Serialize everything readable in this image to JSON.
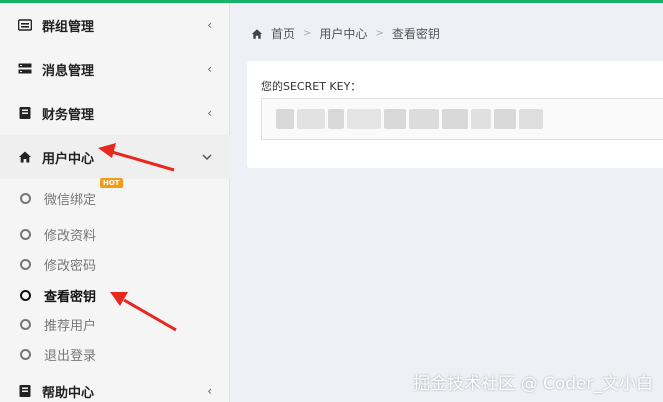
{
  "sidebar": {
    "menus": [
      {
        "label": "群组管理",
        "icon": "keyboard-icon",
        "chevron": "‹"
      },
      {
        "label": "消息管理",
        "icon": "server-icon",
        "chevron": "‹"
      },
      {
        "label": "财务管理",
        "icon": "book-icon",
        "chevron": "‹"
      },
      {
        "label": "用户中心",
        "icon": "home-icon",
        "chevron": "⌄"
      },
      {
        "label": "帮助中心",
        "icon": "book-icon",
        "chevron": "‹"
      }
    ],
    "submenu": [
      {
        "label": "微信绑定",
        "badge": "HOT"
      },
      {
        "label": "修改资料"
      },
      {
        "label": "修改密码"
      },
      {
        "label": "查看密钥"
      },
      {
        "label": "推荐用户"
      },
      {
        "label": "退出登录"
      }
    ]
  },
  "breadcrumb": {
    "home": "首页",
    "parent": "用户中心",
    "current": "查看密钥",
    "separator": ">"
  },
  "card": {
    "label": "您的SECRET KEY："
  },
  "watermark": "掘金技术社区 @ Coder_文小白",
  "colors": {
    "accent": "#17b26a",
    "annotation": "#e8271e",
    "hot_badge": "#f59b1b"
  }
}
